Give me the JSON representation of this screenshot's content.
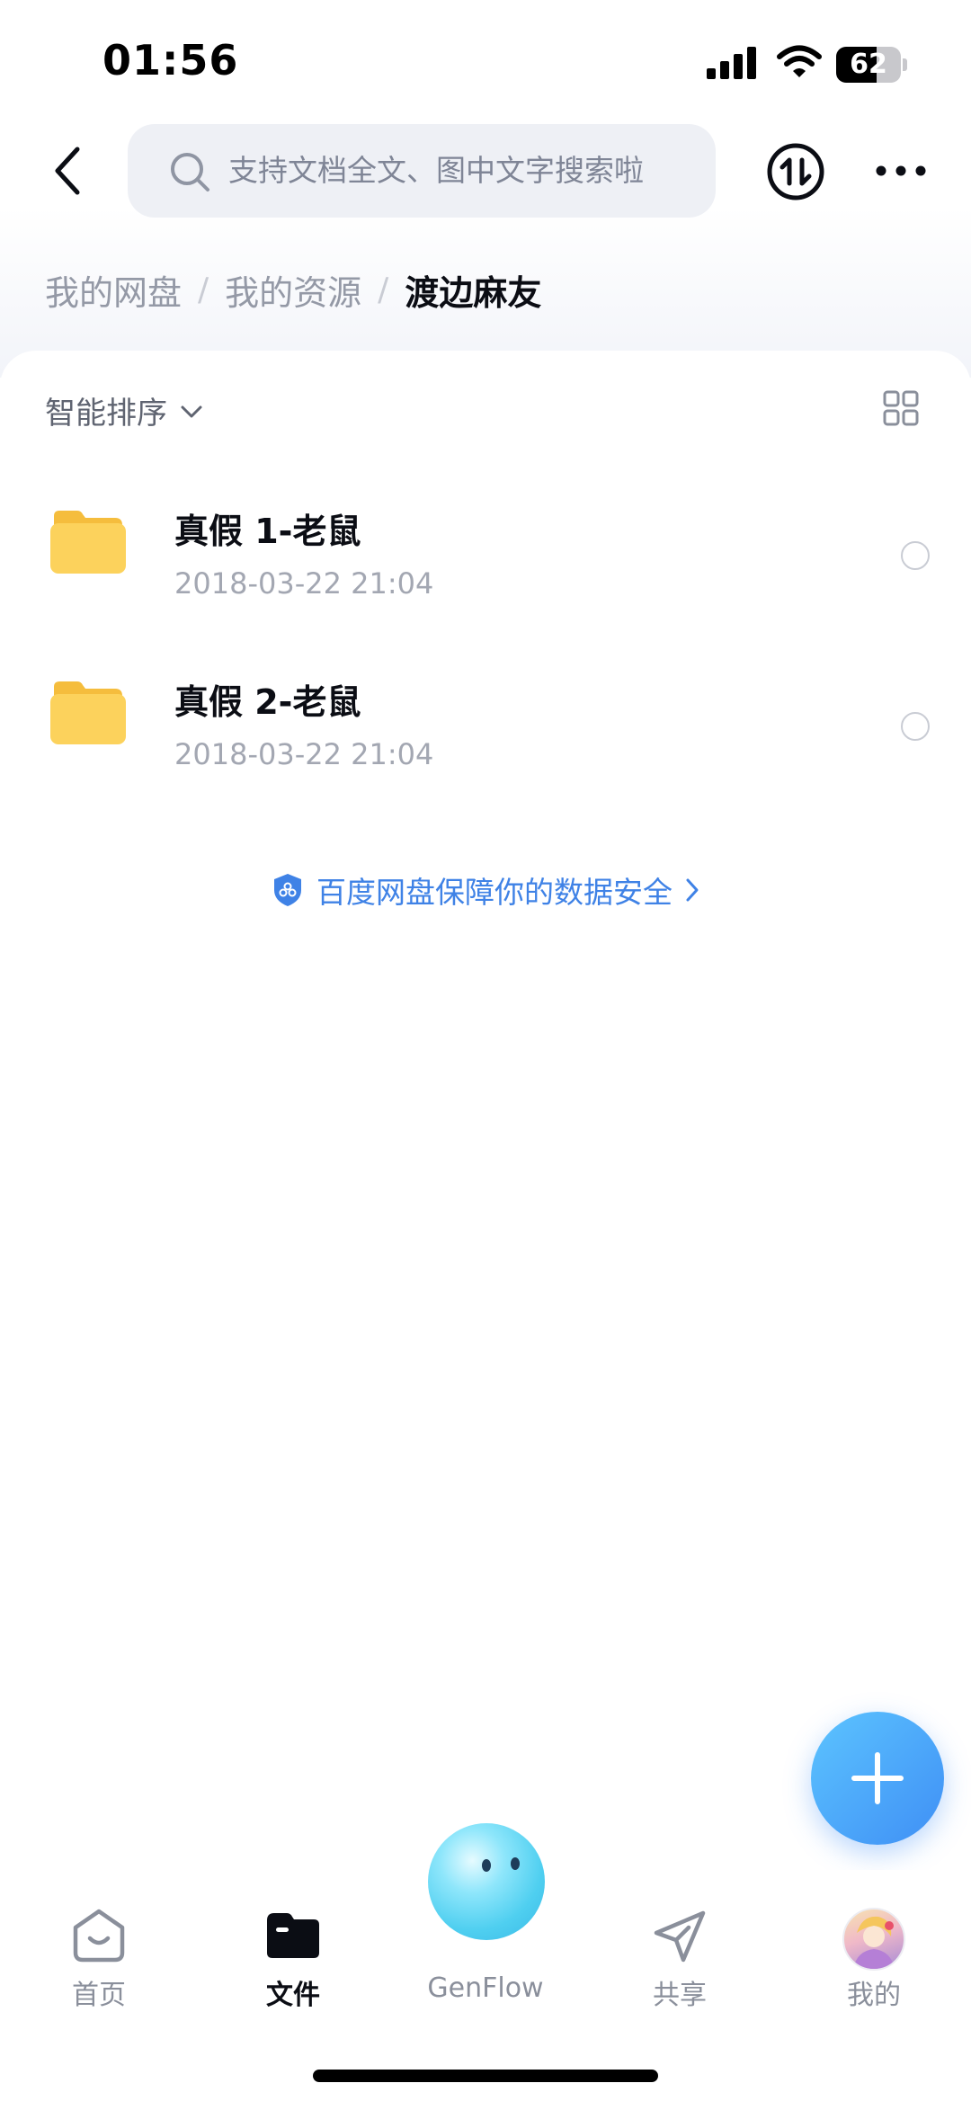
{
  "status_bar": {
    "time": "01:56",
    "battery": "62",
    "battery_level": 0.62,
    "icons": [
      "signal-icon",
      "wifi-icon",
      "battery-icon"
    ]
  },
  "header": {
    "back_icon": "chevron-left-icon",
    "search_placeholder": "支持文档全文、图中文字搜索啦",
    "transfer_icon": "transfer-icon",
    "more_icon": "more-icon"
  },
  "breadcrumb": {
    "items": [
      "我的网盘",
      "我的资源",
      "渡边麻友"
    ],
    "separator": "/"
  },
  "toolbar": {
    "sort_label": "智能排序",
    "view_icon": "grid-view-icon"
  },
  "files": [
    {
      "name": "真假 1-老鼠",
      "date": "2018-03-22 21:04",
      "type": "folder"
    },
    {
      "name": "真假 2-老鼠",
      "date": "2018-03-22 21:04",
      "type": "folder"
    }
  ],
  "security_notice": "百度网盘保障你的数据安全",
  "bottom_nav": {
    "items": [
      {
        "label": "首页",
        "icon": "home-icon",
        "active": false
      },
      {
        "label": "文件",
        "icon": "folder-icon",
        "active": true
      },
      {
        "label": "GenFlow",
        "icon": "genflow-icon",
        "active": false
      },
      {
        "label": "共享",
        "icon": "send-icon",
        "active": false
      },
      {
        "label": "我的",
        "icon": "avatar",
        "active": false
      }
    ]
  },
  "colors": {
    "accent": "#3f82e6",
    "folder": "#fcd25c",
    "fab": "#4aa6f8"
  }
}
